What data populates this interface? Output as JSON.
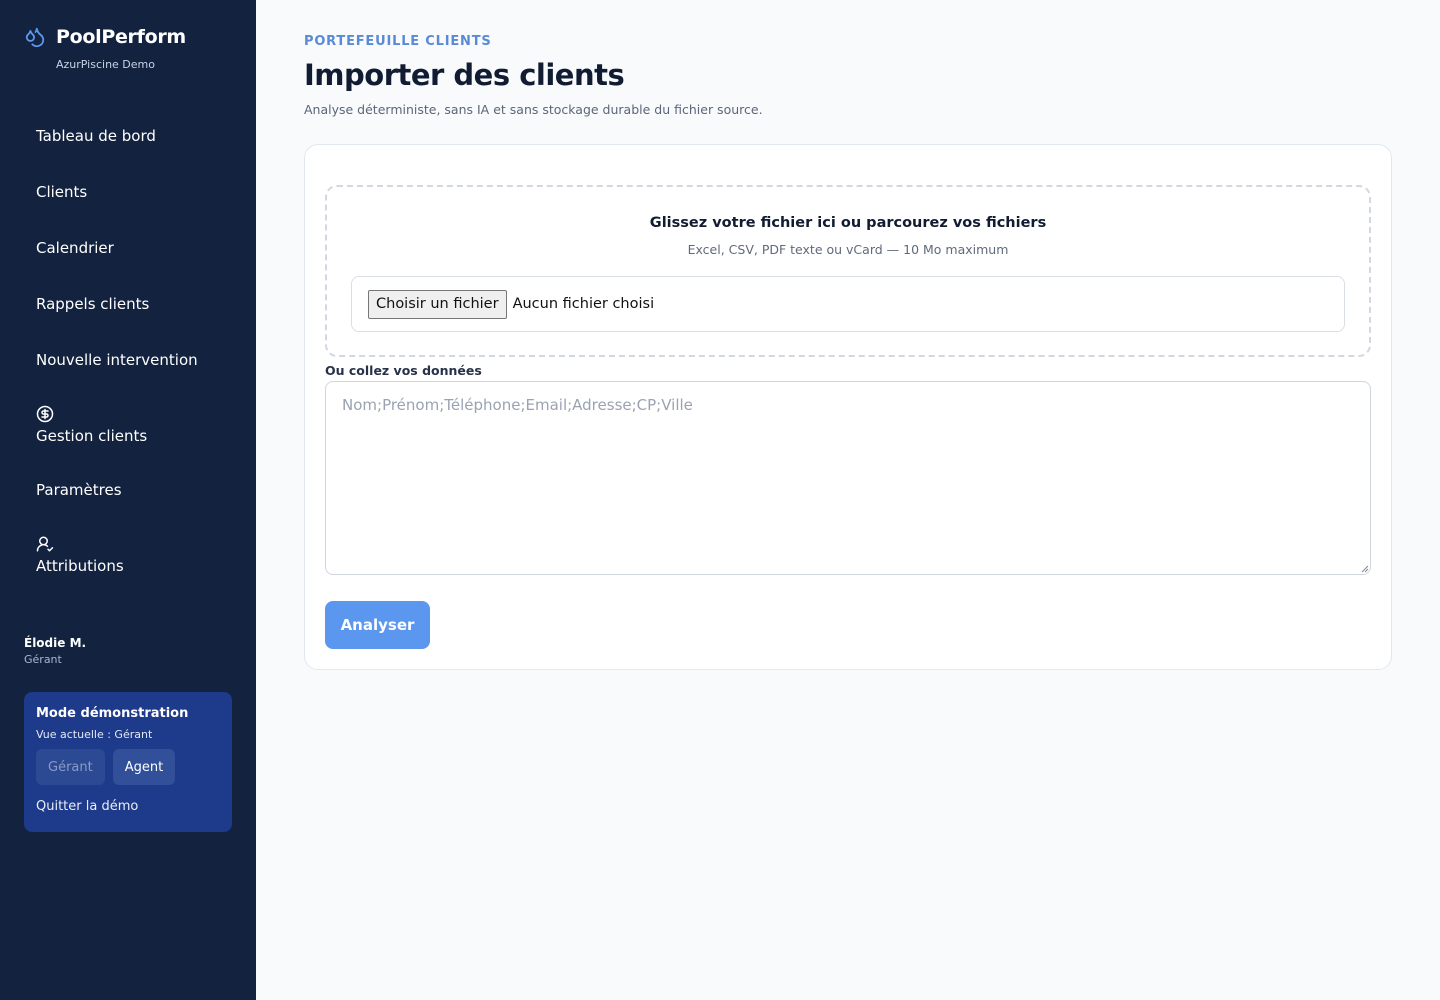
{
  "brand": {
    "name": "PoolPerform",
    "tenant": "AzurPiscine Demo",
    "icon": "water-drops-icon"
  },
  "nav": {
    "items": [
      {
        "label": "Tableau de bord"
      },
      {
        "label": "Clients"
      },
      {
        "label": "Calendrier"
      },
      {
        "label": "Rappels clients"
      },
      {
        "label": "Nouvelle intervention"
      },
      {
        "label": "Gestion clients",
        "icon": "dollar-circle-icon"
      },
      {
        "label": "Paramètres"
      },
      {
        "label": "Attributions",
        "icon": "user-check-icon"
      }
    ]
  },
  "user": {
    "name": "Élodie M.",
    "role": "Gérant"
  },
  "demo": {
    "title": "Mode démonstration",
    "current_view": "Vue actuelle : Gérant",
    "buttons": [
      {
        "label": "Gérant",
        "state": "inactive"
      },
      {
        "label": "Agent",
        "state": "active"
      }
    ],
    "quit_label": "Quitter la démo"
  },
  "header": {
    "eyebrow": "PORTEFEUILLE CLIENTS",
    "title": "Importer des clients",
    "description": "Analyse déterministe, sans IA et sans stockage durable du fichier source."
  },
  "import": {
    "dropzone_title": "Glissez votre fichier ici ou parcourez vos fichiers",
    "dropzone_hint": "Excel, CSV, PDF texte ou vCard — 10 Mo maximum",
    "file_button": "Choisir un fichier",
    "file_status": "Aucun fichier choisi",
    "paste_label": "Ou collez vos données",
    "paste_placeholder": "Nom;Prénom;Téléphone;Email;Adresse;CP;Ville",
    "paste_value": "",
    "analyze_button": "Analyser"
  },
  "colors": {
    "sidebar_bg": "#13223f",
    "demo_panel_bg": "#1e3a8a",
    "accent": "#5a8ad6",
    "primary_button": "#5b97ee",
    "page_bg": "#f8fafc"
  }
}
